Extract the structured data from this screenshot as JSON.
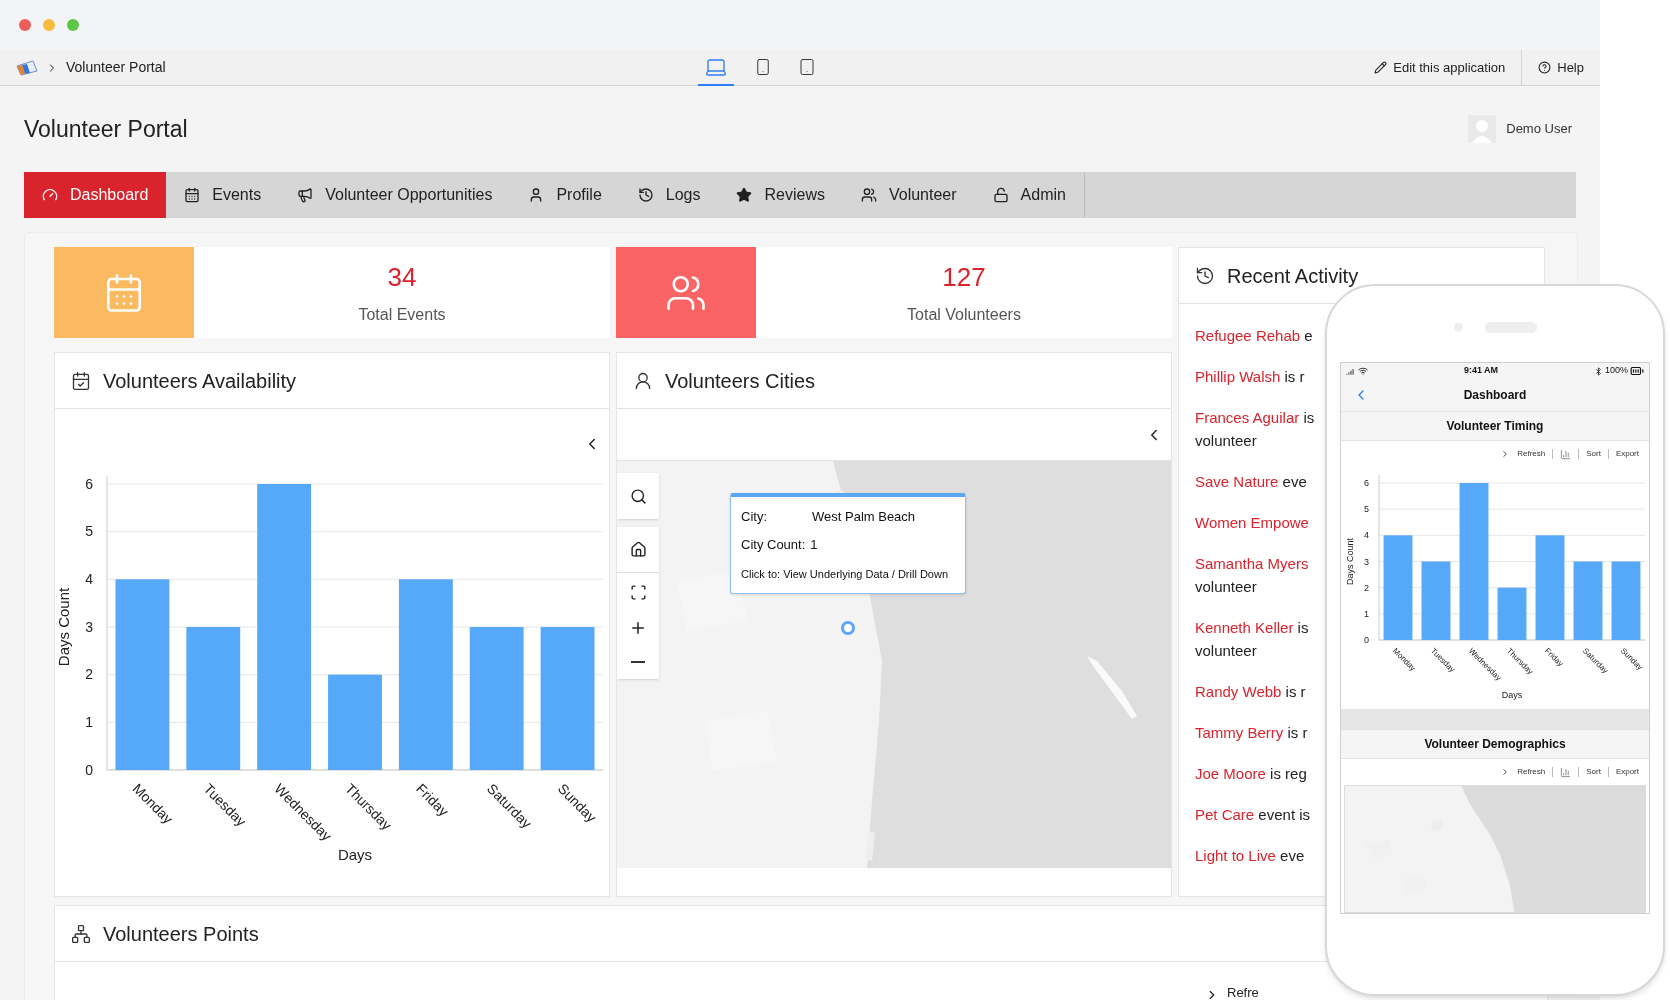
{
  "window": {
    "breadcrumb": "Volunteer Portal"
  },
  "device_toggle": [
    {
      "kind": "laptop",
      "selected": true
    },
    {
      "kind": "phone",
      "selected": false
    },
    {
      "kind": "tablet",
      "selected": false
    }
  ],
  "toolbar_actions": [
    {
      "kind": "edit",
      "label": "Edit this application"
    },
    {
      "kind": "help",
      "label": "Help"
    }
  ],
  "header": {
    "title": "Volunteer Portal",
    "user": "Demo User"
  },
  "nav": [
    {
      "label": "Dashboard",
      "selected": true
    },
    {
      "label": "Events",
      "selected": false
    },
    {
      "label": "Volunteer Opportunities",
      "selected": false
    },
    {
      "label": "Profile",
      "selected": false
    },
    {
      "label": "Logs",
      "selected": false
    },
    {
      "label": "Reviews",
      "selected": false
    },
    {
      "label": "Volunteer",
      "selected": false
    },
    {
      "label": "Admin",
      "selected": false
    }
  ],
  "stats": [
    {
      "kind": "events",
      "value": "34",
      "label": "Total Events",
      "color": "#fbb962"
    },
    {
      "kind": "volunteers",
      "value": "127",
      "label": "Total Volunteers",
      "color": "#fa6464"
    }
  ],
  "availability": {
    "title": "Volunteers Availability",
    "chart_data": {
      "type": "bar",
      "xlabel": "Days",
      "ylabel": "Days Count",
      "categories": [
        "Monday",
        "Tuesday",
        "Wednesday",
        "Thursday",
        "Friday",
        "Saturday",
        "Sunday"
      ],
      "values": [
        4,
        3,
        6,
        2,
        4,
        3,
        3
      ],
      "ylim": [
        0,
        6
      ],
      "yticks": [
        0,
        1,
        2,
        3,
        4,
        5,
        6
      ],
      "grid": true
    }
  },
  "cities": {
    "title": "Volunteers Cities",
    "tooltip": {
      "city_label": "City:",
      "city": "West Palm Beach",
      "count_label": "City Count:",
      "count": "1",
      "hint": "Click to: View Underlying Data / Drill Down"
    }
  },
  "activity": {
    "title": "Recent Activity",
    "items": [
      {
        "link": "Refugee Rehab",
        "text": " e"
      },
      {
        "link": "Phillip Walsh",
        "text": " is r"
      },
      {
        "link": "Frances Aguilar",
        "text": " is",
        "line2": "volunteer"
      },
      {
        "link": "Save Nature",
        "text": " eve"
      },
      {
        "link": "Women Empowe"
      },
      {
        "link": "Samantha Myers",
        "line2": "volunteer"
      },
      {
        "link": "Kenneth Keller",
        "text": " is",
        "line2": "volunteer"
      },
      {
        "link": "Randy Webb",
        "text": " is r"
      },
      {
        "link": "Tammy Berry",
        "text": " is r"
      },
      {
        "link": "Joe Moore",
        "text": " is reg"
      },
      {
        "link": "Pet Care",
        "text": " event is"
      },
      {
        "link": "Light to Live",
        "text": " eve"
      }
    ]
  },
  "points": {
    "title": "Volunteers Points",
    "action": "Refre"
  },
  "phone": {
    "time": "9:41 AM",
    "battery": "100%",
    "title": "Dashboard",
    "sections": [
      {
        "kind": "chart",
        "title": "Volunteer Timing",
        "actions": [
          "Refresh",
          "Sort",
          "Export"
        ],
        "chart_data": {
          "type": "bar",
          "xlabel": "Days",
          "ylabel": "Days Count",
          "categories": [
            "Monday",
            "Tuesday",
            "Wednesday",
            "Thursday",
            "Friday",
            "Saturday",
            "Sunday"
          ],
          "values": [
            4,
            3,
            6,
            2,
            4,
            3,
            3
          ],
          "ylim": [
            0,
            6
          ],
          "yticks": [
            0,
            1,
            2,
            3,
            4,
            5,
            6
          ],
          "grid": true
        }
      },
      {
        "kind": "map",
        "title": "Volunteer Demographics",
        "actions": [
          "Refresh",
          "Sort",
          "Export"
        ]
      }
    ]
  }
}
